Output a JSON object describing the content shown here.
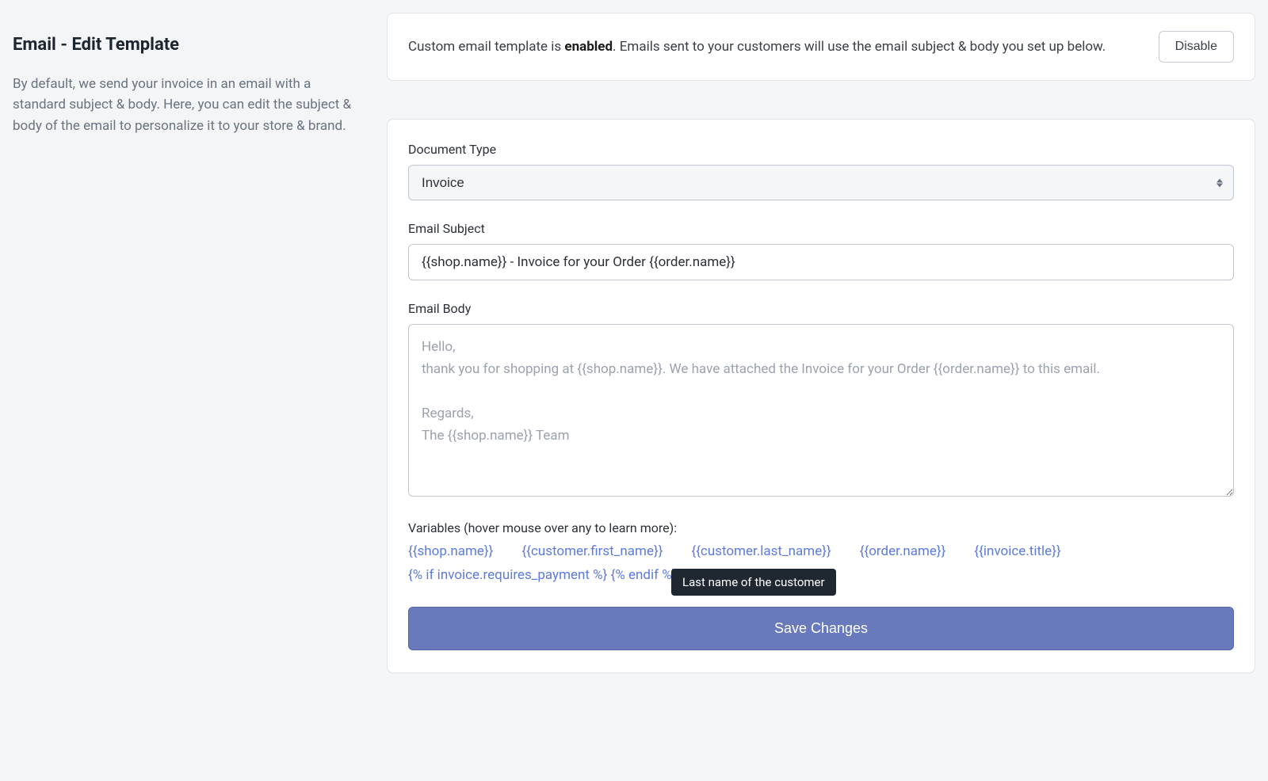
{
  "sidebar": {
    "title": "Email - Edit Template",
    "description": "By default, we send your invoice in an email with a standard subject & body. Here, you can edit the subject & body of the email to personalize it to your store & brand."
  },
  "status": {
    "prefix": "Custom email template is ",
    "enabled_word": "enabled",
    "suffix": ". Emails sent to your customers will use the email subject & body you set up below.",
    "disable_button": "Disable"
  },
  "form": {
    "document_type": {
      "label": "Document Type",
      "value": "Invoice"
    },
    "email_subject": {
      "label": "Email Subject",
      "value": "{{shop.name}} - Invoice for your Order {{order.name}}"
    },
    "email_body": {
      "label": "Email Body",
      "placeholder": "Hello,\nthank you for shopping at {{shop.name}}. We have attached the Invoice for your Order {{order.name}} to this email.\n\nRegards,\nThe {{shop.name}} Team"
    },
    "variables": {
      "label": "Variables (hover mouse over any to learn more):",
      "items": [
        "{{shop.name}}",
        "{{customer.first_name}}",
        "{{customer.last_name}}",
        "{{order.name}}",
        "{{invoice.title}}",
        "{% if invoice.requires_payment %} {% endif %}"
      ],
      "tooltip": "Last name of the customer"
    },
    "save_button": "Save Changes"
  }
}
